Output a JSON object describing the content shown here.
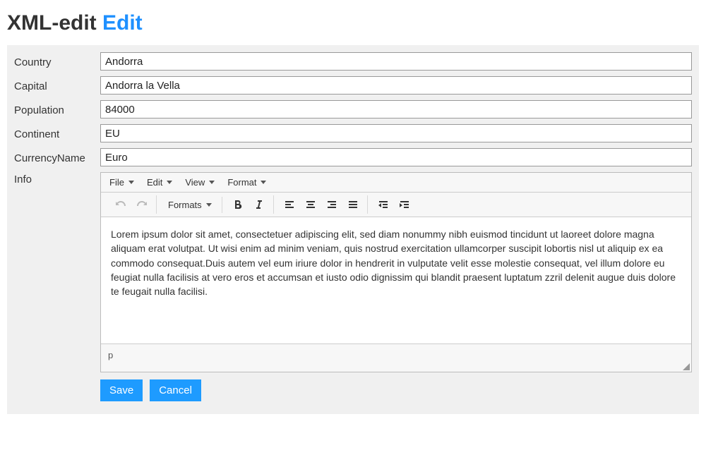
{
  "page": {
    "title_prefix": "XML-edit",
    "title_accent": "Edit"
  },
  "form": {
    "labels": {
      "country": "Country",
      "capital": "Capital",
      "population": "Population",
      "continent": "Continent",
      "currency_name": "CurrencyName",
      "info": "Info"
    },
    "values": {
      "country": "Andorra",
      "capital": "Andorra la Vella",
      "population": "84000",
      "continent": "EU",
      "currency_name": "Euro",
      "info": "Lorem ipsum dolor sit amet, consectetuer adipiscing elit, sed diam nonummy nibh euismod tincidunt ut laoreet dolore magna aliquam erat volutpat. Ut wisi enim ad minim veniam, quis nostrud exercitation ullamcorper suscipit lobortis nisl ut aliquip ex ea commodo consequat.Duis autem vel eum iriure dolor in hendrerit in vulputate velit esse molestie consequat, vel illum dolore eu feugiat nulla facilisis at vero eros et accumsan et iusto odio dignissim qui blandit praesent luptatum zzril delenit augue duis dolore te feugait nulla facilisi."
    }
  },
  "editor": {
    "menu": {
      "file": "File",
      "edit": "Edit",
      "view": "View",
      "format": "Format"
    },
    "toolbar": {
      "formats": "Formats"
    },
    "status_path": "p"
  },
  "buttons": {
    "save": "Save",
    "cancel": "Cancel"
  }
}
